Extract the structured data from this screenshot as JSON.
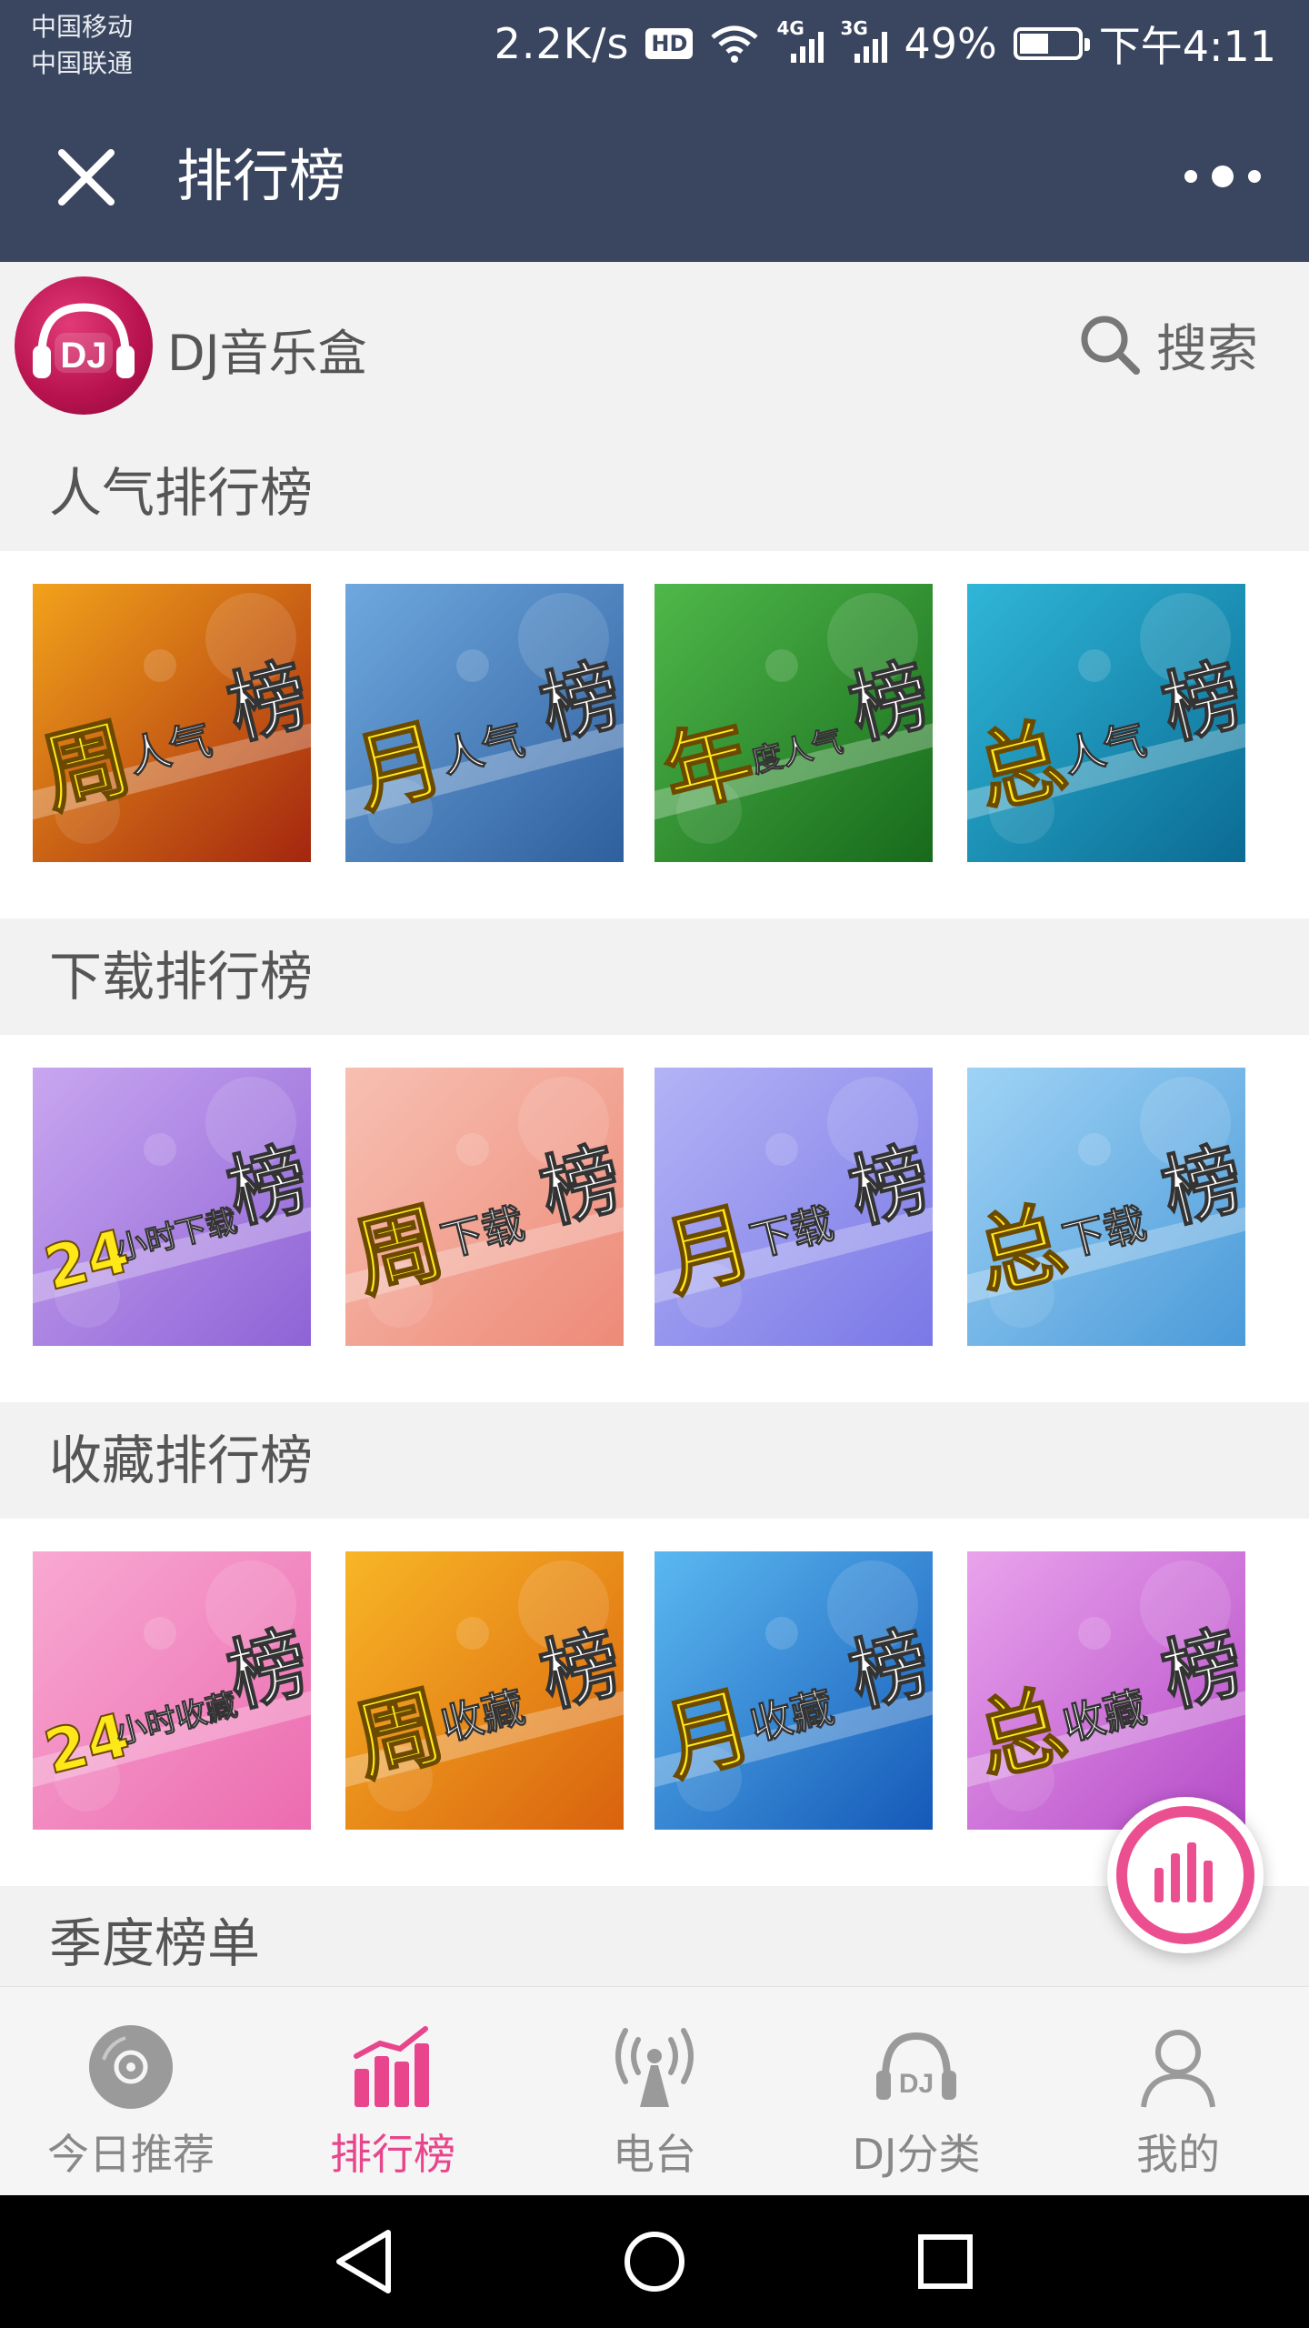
{
  "status_bar": {
    "carrier_1": "中国移动",
    "carrier_2": "中国联通",
    "net_speed": "2.2K/s",
    "hd": "HD",
    "net_4g": "4G",
    "net_3g": "3G",
    "battery": "49%",
    "time": "下午4:11"
  },
  "titlebar": {
    "title": "排行榜",
    "close_icon": "close-icon",
    "more_icon": "more-dots-icon"
  },
  "header": {
    "logo_text": "DJ",
    "app_name": "DJ音乐盒",
    "search_label": "搜索"
  },
  "sections": [
    {
      "title": "人气排行榜",
      "tiles": [
        {
          "big": "周",
          "small": "人气",
          "end": "榜",
          "colors": [
            "#f2a21b",
            "#a4260f"
          ]
        },
        {
          "big": "月",
          "small": "人气",
          "end": "榜",
          "colors": [
            "#6ea8de",
            "#2f5f9e"
          ]
        },
        {
          "big": "年",
          "small": "度人气",
          "end": "榜",
          "colors": [
            "#4fb84a",
            "#176a1b"
          ]
        },
        {
          "big": "总",
          "small": "人气",
          "end": "榜",
          "colors": [
            "#2fb6d8",
            "#0b6b93"
          ]
        }
      ]
    },
    {
      "title": "下载排行榜",
      "tiles": [
        {
          "big": "24",
          "small": "小时下载",
          "end": "榜",
          "colors": [
            "#c9a6f0",
            "#8e63d6"
          ]
        },
        {
          "big": "周",
          "small": "下载",
          "end": "榜",
          "colors": [
            "#f7c0b2",
            "#ee8a78"
          ]
        },
        {
          "big": "月",
          "small": "下载",
          "end": "榜",
          "colors": [
            "#b3b3f6",
            "#7a78e6"
          ]
        },
        {
          "big": "总",
          "small": "下载",
          "end": "榜",
          "colors": [
            "#9fd3f5",
            "#4b9ad9"
          ]
        }
      ]
    },
    {
      "title": "收藏排行榜",
      "tiles": [
        {
          "big": "24",
          "small": "小时收藏",
          "end": "榜",
          "colors": [
            "#f8a9d2",
            "#ec6bb0"
          ]
        },
        {
          "big": "周",
          "small": "收藏",
          "end": "榜",
          "colors": [
            "#f8b626",
            "#d9620e"
          ]
        },
        {
          "big": "月",
          "small": "收藏",
          "end": "榜",
          "colors": [
            "#5bb8f0",
            "#1559b8"
          ]
        },
        {
          "big": "总",
          "small": "收藏",
          "end": "榜",
          "colors": [
            "#e9a3ec",
            "#b54bc8"
          ]
        }
      ]
    },
    {
      "title": "季度榜单",
      "tiles": []
    }
  ],
  "tabbar": [
    {
      "label": "今日推荐",
      "icon": "disc-icon",
      "active": false
    },
    {
      "label": "排行榜",
      "icon": "chart-bars-icon",
      "active": true
    },
    {
      "label": "电台",
      "icon": "radio-tower-icon",
      "active": false
    },
    {
      "label": "DJ分类",
      "icon": "dj-headphones-icon",
      "active": false
    },
    {
      "label": "我的",
      "icon": "user-icon",
      "active": false
    }
  ],
  "fab": {
    "icon": "equalizer-icon"
  },
  "colors": {
    "bar_bg": "#3a465f",
    "accent": "#e8458c",
    "logo": "#b8124e"
  },
  "navbar": {
    "back": "back-icon",
    "home": "home-icon",
    "recents": "recents-icon"
  }
}
